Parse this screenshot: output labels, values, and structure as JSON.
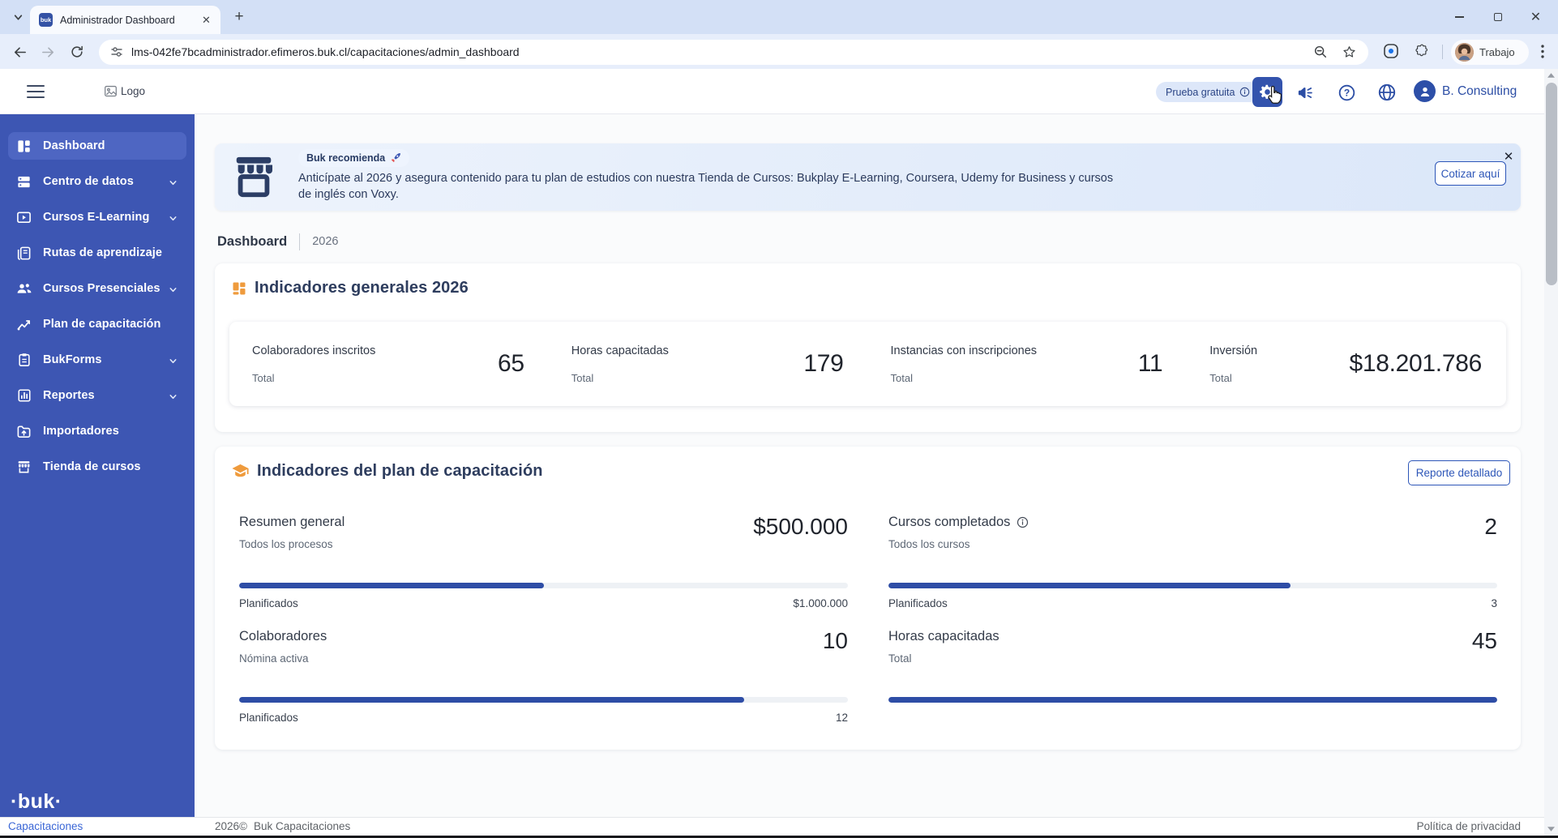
{
  "browser": {
    "tab_title": "Administrador Dashboard",
    "favicon_text": "buk",
    "url": "lms-042fe7bcadministrador.efimeros.buk.cl/capacitaciones/admin_dashboard",
    "profile_name": "Trabajo"
  },
  "app_header": {
    "logo_alt": "Logo",
    "trial_badge": "Prueba gratuita",
    "account_name": "B. Consulting"
  },
  "sidebar": {
    "items": [
      {
        "label": "Dashboard"
      },
      {
        "label": "Centro de datos"
      },
      {
        "label": "Cursos E-Learning"
      },
      {
        "label": "Rutas de aprendizaje"
      },
      {
        "label": "Cursos Presenciales"
      },
      {
        "label": "Plan de capacitación"
      },
      {
        "label": "BukForms"
      },
      {
        "label": "Reportes"
      },
      {
        "label": "Importadores"
      },
      {
        "label": "Tienda de cursos"
      }
    ],
    "brand": "·buk·"
  },
  "banner": {
    "badge": "Buk recomienda",
    "text": "Anticípate al 2026 y asegura contenido para tu plan de estudios con nuestra Tienda de Cursos: Bukplay E-Learning, Coursera, Udemy for Business y cursos de inglés con Voxy.",
    "cta": "Cotizar aquí"
  },
  "breadcrumb": {
    "section": "Dashboard",
    "year": "2026"
  },
  "general": {
    "title": "Indicadores generales 2026",
    "stats": [
      {
        "label": "Colaboradores inscritos",
        "sublabel": "Total",
        "value": "65"
      },
      {
        "label": "Horas capacitadas",
        "sublabel": "Total",
        "value": "179"
      },
      {
        "label": "Instancias con inscripciones",
        "sublabel": "Total",
        "value": "11"
      },
      {
        "label": "Inversión",
        "sublabel": "Total",
        "value": "$18.201.786"
      }
    ]
  },
  "plan": {
    "title": "Indicadores del plan de capacitación",
    "report_button": "Reporte detallado",
    "metrics": [
      {
        "label": "Resumen general",
        "sublabel": "Todos los procesos",
        "value": "$500.000",
        "progress_pct": 50,
        "planned_label": "Planificados",
        "planned_value": "$1.000.000"
      },
      {
        "label": "Cursos completados",
        "sublabel": "Todos los cursos",
        "value": "2",
        "progress_pct": 66,
        "planned_label": "Planificados",
        "planned_value": "3"
      },
      {
        "label": "Colaboradores",
        "sublabel": "Nómina activa",
        "value": "10",
        "progress_pct": 83,
        "planned_label": "Planificados",
        "planned_value": "12"
      },
      {
        "label": "Horas capacitadas",
        "sublabel": "Total",
        "value": "45",
        "progress_pct": 100
      }
    ]
  },
  "footer": {
    "app_link": "Capacitaciones",
    "copyright": "2026©",
    "brand": "Buk Capacitaciones",
    "privacy": "Política de privacidad"
  },
  "colors": {
    "sidebar_blue": "#3d56b3",
    "accent_blue": "#2d56b8",
    "progress_blue": "#2e4da6",
    "orange": "#ef9b3d",
    "navy": "#2c3e66"
  }
}
